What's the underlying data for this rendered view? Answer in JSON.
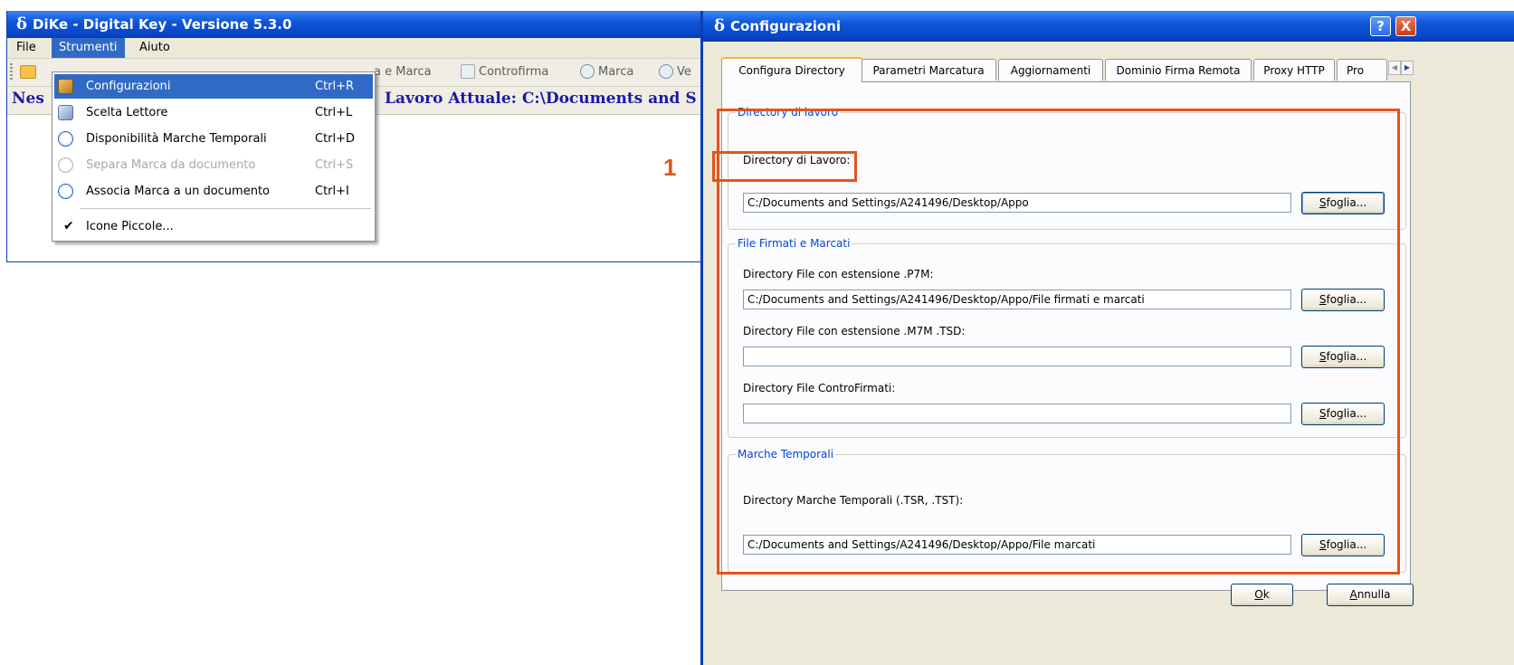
{
  "main_window": {
    "title": "DiKe - Digital Key - Versione 5.3.0",
    "menu": [
      "File",
      "Strumenti",
      "Aiuto"
    ],
    "toolbar": {
      "sign_mark_label": "a e Marca",
      "countersign_label": "Controfirma",
      "mark_label": "Marca",
      "verify_label": "Ve"
    },
    "status": {
      "left_text": "Nes",
      "directory_text": "Lavoro Attuale: C:\\Documents and S"
    }
  },
  "dropdown": {
    "items": [
      {
        "label": "Configurazioni",
        "shortcut": "Ctrl+R"
      },
      {
        "label": "Scelta Lettore",
        "shortcut": "Ctrl+L"
      },
      {
        "label": "Disponibilità Marche Temporali",
        "shortcut": "Ctrl+D"
      },
      {
        "label": "Separa Marca da documento",
        "shortcut": "Ctrl+S"
      },
      {
        "label": "Associa Marca a un documento",
        "shortcut": "Ctrl+I"
      },
      {
        "label": "Icone Piccole...",
        "shortcut": ""
      }
    ]
  },
  "dialog": {
    "title": "Configurazioni",
    "help_glyph": "?",
    "close_glyph": "X",
    "tabs": [
      "Configura Directory",
      "Parametri Marcatura",
      "Aggiornamenti",
      "Dominio Firma Remota",
      "Proxy HTTP",
      "Pro"
    ],
    "groups": {
      "lavoro": {
        "legend": "Directory di lavoro",
        "label": "Directory di Lavoro:",
        "value": "C:/Documents and Settings/A241496/Desktop/Appo"
      },
      "firmati": {
        "legend": "File Firmati e Marcati",
        "p7m_label": "Directory File con estensione .P7M:",
        "p7m_value": "C:/Documents and Settings/A241496/Desktop/Appo/File firmati e marcati",
        "m7m_label": "Directory File con estensione .M7M .TSD:",
        "m7m_value": "",
        "contro_label": "Directory File ControFirmati:",
        "contro_value": ""
      },
      "marche": {
        "legend": "Marche Temporali",
        "label": "Directory Marche Temporali (.TSR, .TST):",
        "value": "C:/Documents and Settings/A241496/Desktop/Appo/File marcati"
      }
    },
    "browse": {
      "accel": "S",
      "rest": "foglia..."
    },
    "ok": {
      "accel": "O",
      "rest": "k"
    },
    "cancel": {
      "accel": "A",
      "rest": "nnulla"
    }
  },
  "annotation": {
    "number": "1",
    "color": "#e2561b"
  }
}
